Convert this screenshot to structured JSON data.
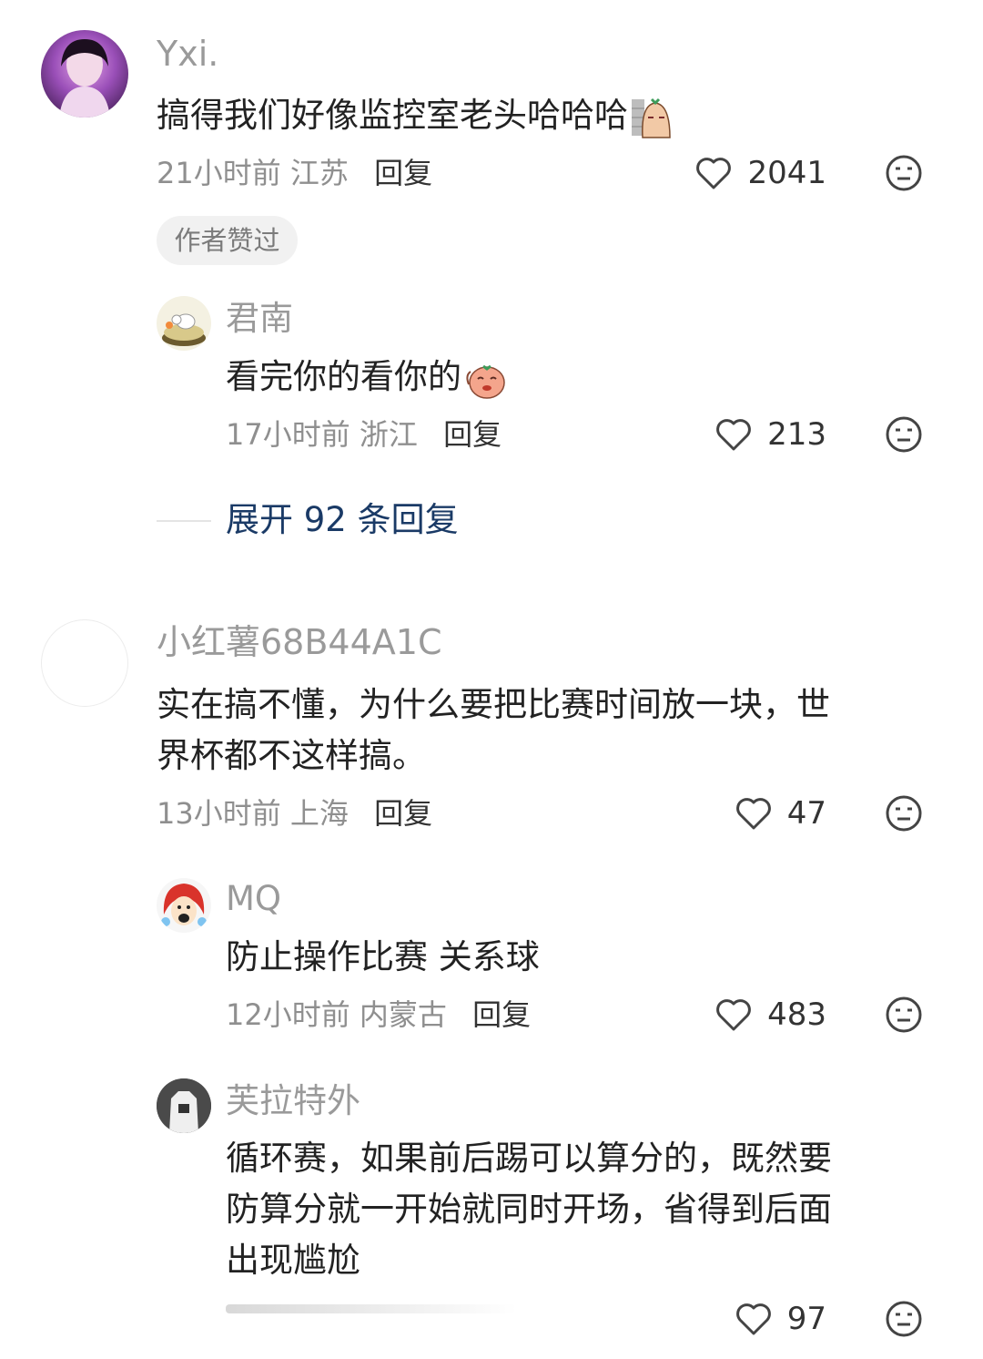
{
  "comments": [
    {
      "user": "Yxi.",
      "text": "搞得我们好像监控室老头哈哈哈",
      "time": "21小时前",
      "location": "江苏",
      "reply_label": "回复",
      "likes": "2041",
      "tag": "作者赞过",
      "avatar_icon": "girl-photo-avatar",
      "sticker_icon": "peeking-potato-sticker"
    },
    {
      "user": "君南",
      "text": "看完你的看你的",
      "time": "17小时前",
      "location": "浙江",
      "reply_label": "回复",
      "likes": "213",
      "avatar_icon": "duck-cartoon-avatar",
      "sticker_icon": "shy-potato-sticker"
    },
    {
      "user": "小红薯68B44A1C",
      "text_line1": "实在搞不懂，为什么要把比赛时间放一块，世",
      "text_line2": "界杯都不这样搞。",
      "time": "13小时前",
      "location": "上海",
      "reply_label": "回复",
      "likes": "47",
      "avatar_icon": "blank-avatar"
    },
    {
      "user": "MQ",
      "text": "防止操作比赛  关系球",
      "time": "12小时前",
      "location": "内蒙古",
      "reply_label": "回复",
      "likes": "483",
      "avatar_icon": "cartoon-face-avatar"
    },
    {
      "user": "芙拉特外",
      "text_line1": "循环赛，如果前后踢可以算分的，既然要",
      "text_line2": "防算分就一开始就同时开场，省得到后面",
      "text_line3": "出现尴尬",
      "likes": "97",
      "avatar_icon": "shirt-photo-avatar"
    }
  ],
  "expand_replies": "展开 92 条回复",
  "colors": {
    "expand_link": "#1a3a66",
    "username": "#9a9a9a",
    "text": "#222222"
  }
}
